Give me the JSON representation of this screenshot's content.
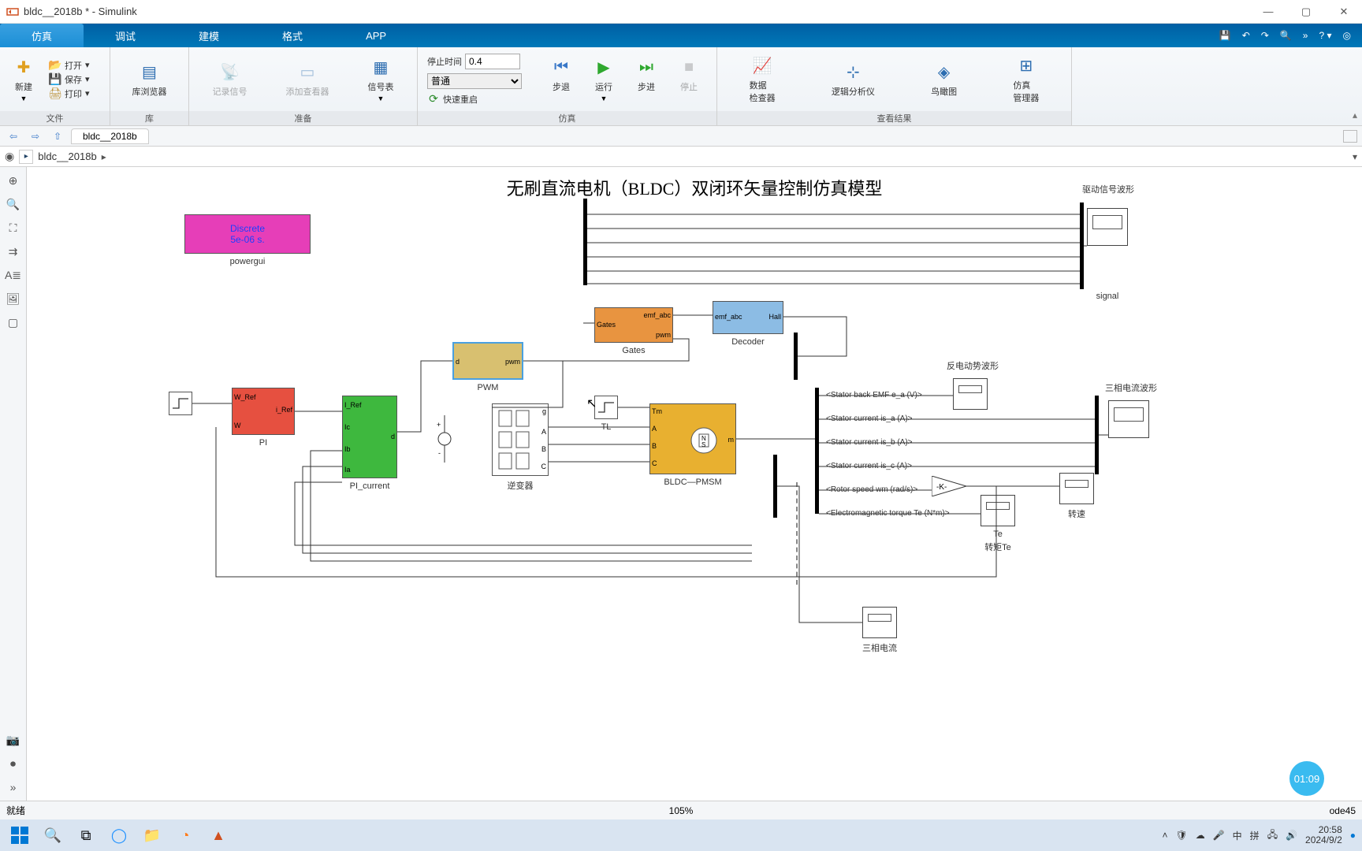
{
  "window": {
    "title": "bldc__2018b * - Simulink"
  },
  "tabs": [
    "仿真",
    "调试",
    "建模",
    "格式",
    "APP"
  ],
  "ribbon": {
    "file": {
      "new": "新建",
      "open": "打开",
      "save": "保存",
      "print": "打印",
      "group": "文件"
    },
    "library": {
      "browser": "库浏览器",
      "group": "库"
    },
    "prepare": {
      "log": "记录信号",
      "viewer": "添加查看器",
      "table": "信号表",
      "group": "准备"
    },
    "sim": {
      "stopTimeLabel": "停止时间",
      "stopTime": "0.4",
      "mode": "普通",
      "fastRestart": "快速重启",
      "stepBack": "步退",
      "run": "运行",
      "stepFwd": "步进",
      "stop": "停止",
      "group": "仿真"
    },
    "results": {
      "dataInspect": "数据\n检查器",
      "logic": "逻辑分析仪",
      "bird": "鸟瞰图",
      "simMgr": "仿真\n管理器",
      "group": "查看结果"
    }
  },
  "nav": {
    "tab": "bldc__2018b"
  },
  "breadcrumb": {
    "text": "bldc__2018b"
  },
  "canvas": {
    "title": "无刷直流电机（BLDC）双闭环矢量控制仿真模型",
    "powergui": {
      "line1": "Discrete",
      "line2": "5e-06 s.",
      "label": "powergui"
    },
    "blocks": {
      "pi": {
        "wref": "W_Ref",
        "w": "W",
        "iref": "i_Ref",
        "label": "PI"
      },
      "pi_current": {
        "iref": "I_Ref",
        "ic": "Ic",
        "ib": "Ib",
        "ia": "Ia",
        "d": "d",
        "label": "PI_current"
      },
      "pwm": {
        "d": "d",
        "pwm": "pwm",
        "label": "PWM"
      },
      "gates": {
        "gates": "Gates",
        "emf": "emf_abc",
        "pwm": "pwm",
        "label": "Gates"
      },
      "decoder": {
        "emf": "emf_abc",
        "hall": "Hall",
        "label": "Decoder"
      },
      "inverter": {
        "g": "g",
        "A": "A",
        "B": "B",
        "C": "C",
        "label": "逆变器"
      },
      "tl": {
        "label": "TL"
      },
      "motor": {
        "tm": "Tm",
        "A": "A",
        "B": "B",
        "C": "C",
        "m": "m",
        "label": "BLDC—PMSM"
      },
      "gain": {
        "text": "-K-"
      },
      "signals": {
        "emf_a": "<Stator back EMF e_a (V)>",
        "is_a": "<Stator current is_a (A)>",
        "is_b": "<Stator current is_b (A)>",
        "is_c": "<Stator current is_c (A)>",
        "wm": "<Rotor speed wm (rad/s)>",
        "te": "<Electromagnetic torque Te (N*m)>"
      }
    },
    "scopeLabels": {
      "drive": "驱动信号波形",
      "signal": "signal",
      "emf": "反电动势波形",
      "current3": "三相电流波形",
      "speed": "转速",
      "te": "Te",
      "teTorque": "转矩Te",
      "currentBottom": "三相电流"
    }
  },
  "status": {
    "ready": "就绪",
    "zoom": "105%",
    "solver": "ode45"
  },
  "badge": {
    "time": "01:09"
  },
  "tray": {
    "ime": "中",
    "ime2": "拼",
    "time": "20:58",
    "date": "2024/9/2"
  }
}
